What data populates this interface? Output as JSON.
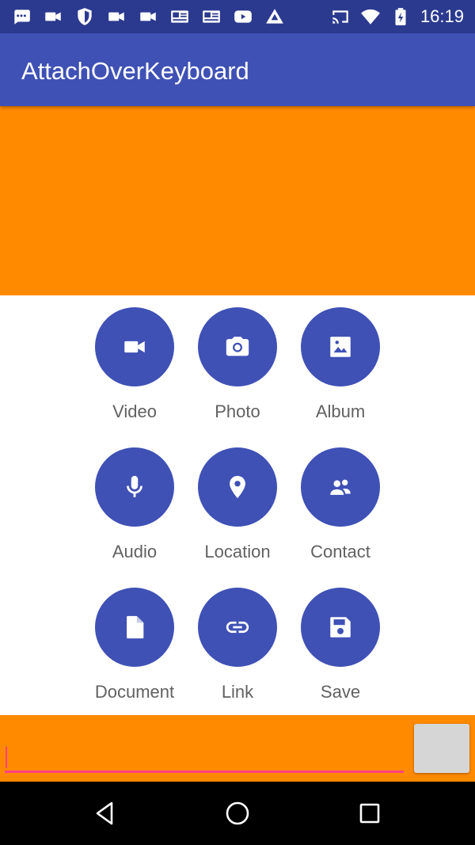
{
  "status_bar": {
    "time": "16:19",
    "left_icons": [
      "messages-icon",
      "video-call-icon",
      "shield-icon",
      "video-camera-icon",
      "video-camera-icon",
      "news-icon",
      "news-icon",
      "youtube-icon",
      "app-icon"
    ],
    "right_icons": [
      "cast-icon",
      "wifi-icon",
      "battery-charging-icon"
    ]
  },
  "app_bar": {
    "title": "AttachOverKeyboard"
  },
  "attachments": [
    {
      "label": "Video",
      "icon": "videocam-icon"
    },
    {
      "label": "Photo",
      "icon": "camera-icon"
    },
    {
      "label": "Album",
      "icon": "image-icon"
    },
    {
      "label": "Audio",
      "icon": "mic-icon"
    },
    {
      "label": "Location",
      "icon": "location-pin-icon"
    },
    {
      "label": "Contact",
      "icon": "contacts-icon"
    },
    {
      "label": "Document",
      "icon": "document-icon"
    },
    {
      "label": "Link",
      "icon": "link-icon"
    },
    {
      "label": "Save",
      "icon": "save-icon"
    }
  ],
  "input_bar": {
    "message_value": "",
    "message_placeholder": ""
  },
  "nav_bar": {
    "buttons": [
      "back-icon",
      "home-icon",
      "recents-icon"
    ]
  },
  "colors": {
    "status_bar": "#2b3a8f",
    "primary": "#3f51b5",
    "orange": "#ff8a00",
    "accent": "#ff4081",
    "label_gray": "#616161"
  }
}
